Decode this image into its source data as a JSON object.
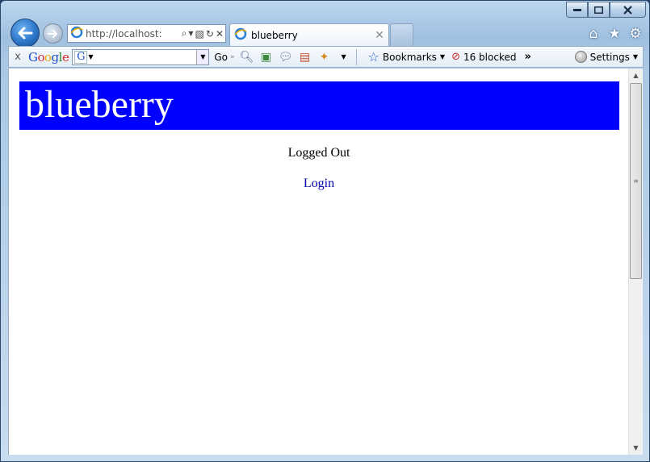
{
  "browser": {
    "address": {
      "url": "http://localhost:"
    },
    "tab": {
      "title": "blueberry"
    },
    "caption_buttons": [
      "minimize-icon",
      "maximize-icon",
      "close-icon"
    ],
    "right_icons": [
      "home-icon",
      "favorites-star-icon",
      "tools-gear-icon"
    ]
  },
  "google_toolbar": {
    "close": "x",
    "logo": "Google",
    "search_icon_letter": "G",
    "go_label": "Go",
    "chevron_label": "»",
    "bookmarks_label": "Bookmarks",
    "blocked_label": "16 blocked",
    "more_label": "»",
    "settings_label": "Settings"
  },
  "page": {
    "banner_title": "blueberry",
    "status": "Logged Out",
    "login_label": "Login",
    "banner_color": "#0000ff",
    "link_color": "#0000aa"
  }
}
